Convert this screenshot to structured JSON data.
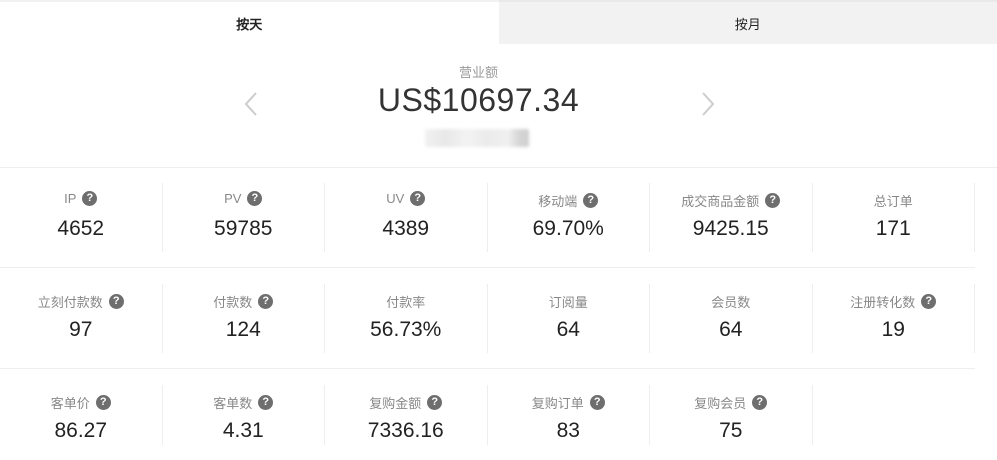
{
  "tabs": [
    {
      "label": "按天",
      "active": true
    },
    {
      "label": "按月",
      "active": false
    }
  ],
  "summary": {
    "label": "营业额",
    "value": "US$10697.34"
  },
  "metrics": [
    [
      {
        "label": "IP",
        "value": "4652",
        "help": true
      },
      {
        "label": "PV",
        "value": "59785",
        "help": true
      },
      {
        "label": "UV",
        "value": "4389",
        "help": true
      },
      {
        "label": "移动端",
        "value": "69.70%",
        "help": true
      },
      {
        "label": "成交商品金额",
        "value": "9425.15",
        "help": true
      },
      {
        "label": "总订单",
        "value": "171",
        "help": false
      }
    ],
    [
      {
        "label": "立刻付款数",
        "value": "97",
        "help": true
      },
      {
        "label": "付款数",
        "value": "124",
        "help": true
      },
      {
        "label": "付款率",
        "value": "56.73%",
        "help": false
      },
      {
        "label": "订阅量",
        "value": "64",
        "help": false
      },
      {
        "label": "会员数",
        "value": "64",
        "help": false
      },
      {
        "label": "注册转化数",
        "value": "19",
        "help": true
      }
    ],
    [
      {
        "label": "客单价",
        "value": "86.27",
        "help": true
      },
      {
        "label": "客单数",
        "value": "4.31",
        "help": true
      },
      {
        "label": "复购金额",
        "value": "7336.16",
        "help": true
      },
      {
        "label": "复购订单",
        "value": "83",
        "help": true
      },
      {
        "label": "复购会员",
        "value": "75",
        "help": true
      }
    ]
  ],
  "help_glyph": "?",
  "colors": {
    "tab_inactive_bg": "#f2f2f2",
    "help_icon_bg": "#6e6e6e",
    "divider": "#eeeeee"
  }
}
